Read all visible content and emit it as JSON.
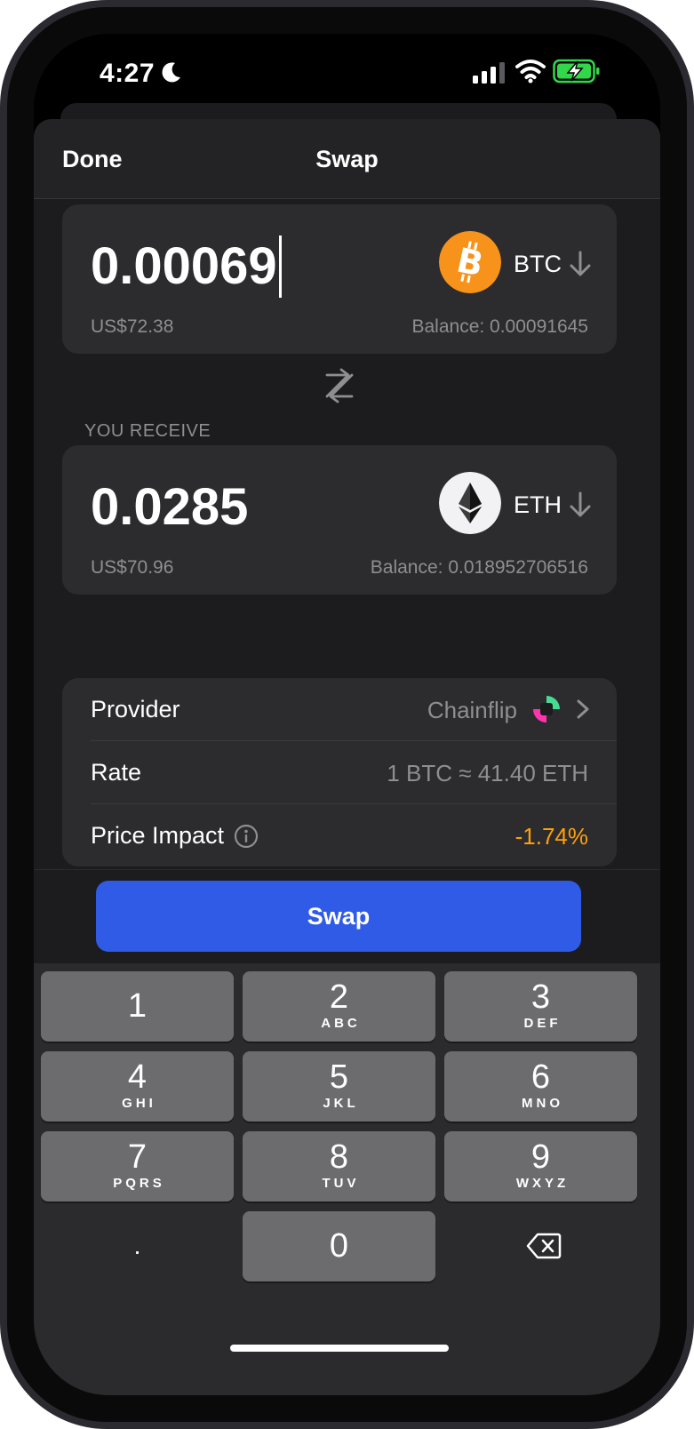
{
  "status_bar": {
    "time": "4:27"
  },
  "nav": {
    "done_label": "Done",
    "title": "Swap"
  },
  "pay": {
    "amount": "0.00069",
    "usd_value": "US$72.38",
    "balance": "Balance: 0.00091645",
    "token_symbol": "BTC",
    "token_color": "#f7931a"
  },
  "receive": {
    "section_label": "YOU RECEIVE",
    "amount": "0.0285",
    "usd_value": "US$70.96",
    "balance": "Balance: 0.018952706516",
    "token_symbol": "ETH"
  },
  "details": {
    "provider_label": "Provider",
    "provider_value": "Chainflip",
    "rate_label": "Rate",
    "rate_value": "1 BTC ≈ 41.40 ETH",
    "impact_label": "Price Impact",
    "impact_value": "-1.74%",
    "impact_color": "#ff9f0a"
  },
  "swap_button_label": "Swap",
  "accent_color": "#2f5be7",
  "keypad": {
    "keys": [
      {
        "num": "1",
        "sub": ""
      },
      {
        "num": "2",
        "sub": "ABC"
      },
      {
        "num": "3",
        "sub": "DEF"
      },
      {
        "num": "4",
        "sub": "GHI"
      },
      {
        "num": "5",
        "sub": "JKL"
      },
      {
        "num": "6",
        "sub": "MNO"
      },
      {
        "num": "7",
        "sub": "PQRS"
      },
      {
        "num": "8",
        "sub": "TUV"
      },
      {
        "num": "9",
        "sub": "WXYZ"
      },
      {
        "num": ".",
        "sub": ""
      },
      {
        "num": "0",
        "sub": ""
      }
    ]
  }
}
